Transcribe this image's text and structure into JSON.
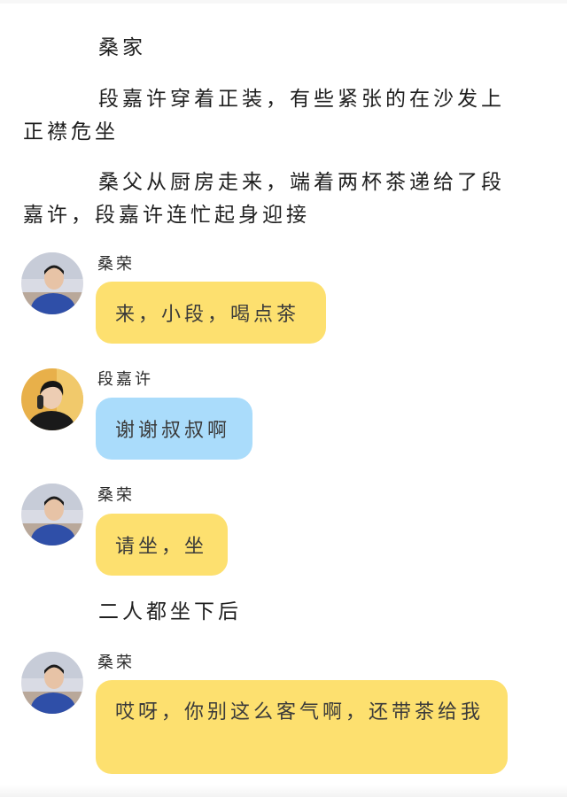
{
  "scene": {
    "location": "桑家",
    "line1": "段嘉许穿着正装，有些紧张的在沙发上正襟危坐",
    "line2": "桑父从厨房走来，端着两杯茶递给了段嘉许，段嘉许连忙起身迎接",
    "line3": "二人都坐下后"
  },
  "messages": [
    {
      "speaker": "桑荣",
      "text": "来，小段，喝点茶",
      "color": "#fde06f",
      "avatar": "father-avatar"
    },
    {
      "speaker": "段嘉许",
      "text": "谢谢叔叔啊",
      "color": "#aadcfb",
      "avatar": "duan-avatar"
    },
    {
      "speaker": "桑荣",
      "text": "请坐，坐",
      "color": "#fde06f",
      "avatar": "father-avatar"
    },
    {
      "speaker": "桑荣",
      "text": "哎呀，你别这么客气啊，还带茶给我",
      "color": "#fde06f",
      "avatar": "father-avatar"
    }
  ]
}
